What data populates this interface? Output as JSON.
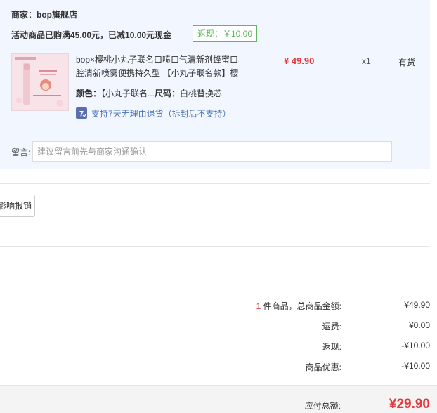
{
  "shop": {
    "name_label": "商家：bop旗舰店",
    "promo_text": "活动商品已购满45.00元，已减10.00元现金",
    "rebate_tag": "返现：￥10.00"
  },
  "item": {
    "title": "bop×樱桃小丸子联名口喷口气清新剂蜂蜜口腔清新喷雾便携持久型 【小丸子联名款】樱",
    "spec_color_label": "颜色：",
    "spec_color_value": "【小丸子联名...",
    "spec_size_label": "尺码：",
    "spec_size_value": "白桃替换芯",
    "return_policy": "支持7天无理由退货（拆封后不支持）",
    "return_icon_text": "7",
    "price": "¥ 49.90",
    "quantity": "x1",
    "stock_status": "有货",
    "thumbnail_icon": "product-thumbnail"
  },
  "message": {
    "label": "留言:",
    "placeholder": "建议留言前先与商家沟通确认"
  },
  "invoice": {
    "button_label": "影响报销"
  },
  "summary": {
    "count": "1",
    "count_label": " 件商品，总商品金额:",
    "goods_total": "¥49.90",
    "shipping_label": "运费:",
    "shipping_value": "¥0.00",
    "rebate_label": "返现:",
    "rebate_value": "-¥10.00",
    "discount_label": "商品优惠:",
    "discount_value": "-¥10.00",
    "payable_label": "应付总额:",
    "payable_value": "¥29.90"
  },
  "colors": {
    "price_red": "#e4393c",
    "panel_bg": "#f2f7ff",
    "rebate_green": "#5fb85f",
    "link_blue": "#4a72b8"
  }
}
